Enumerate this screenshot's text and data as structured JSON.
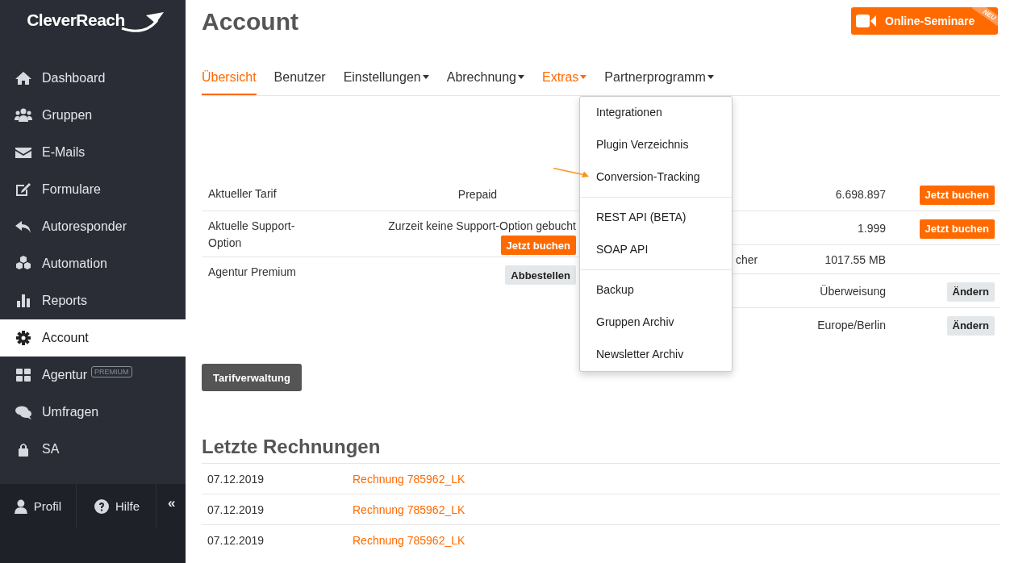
{
  "logo": "CleverReach",
  "sidebar": {
    "items": [
      {
        "label": "Dashboard",
        "selected": false
      },
      {
        "label": "Gruppen",
        "selected": false
      },
      {
        "label": "E-Mails",
        "selected": false
      },
      {
        "label": "Formulare",
        "selected": false
      },
      {
        "label": "Autoresponder",
        "selected": false
      },
      {
        "label": "Automation",
        "selected": false
      },
      {
        "label": "Reports",
        "selected": false
      },
      {
        "label": "Account",
        "selected": true
      },
      {
        "label": "Agentur",
        "selected": false,
        "badge": "PREMIUM"
      },
      {
        "label": "Umfragen",
        "selected": false
      },
      {
        "label": "SA",
        "selected": false
      }
    ],
    "footer": [
      "Profil",
      "Hilfe",
      "«"
    ]
  },
  "page_title": "Account",
  "promo": {
    "label": "Online-Seminare",
    "ribbon": "NEU"
  },
  "tabs": [
    {
      "label": "Übersicht",
      "selected": true,
      "dropdown": false,
      "highlighted": false
    },
    {
      "label": "Benutzer",
      "selected": false,
      "dropdown": false,
      "highlighted": false
    },
    {
      "label": "Einstellungen",
      "selected": false,
      "dropdown": true,
      "highlighted": false
    },
    {
      "label": "Abrechnung",
      "selected": false,
      "dropdown": true,
      "highlighted": false
    },
    {
      "label": "Extras",
      "selected": false,
      "dropdown": true,
      "highlighted": true
    },
    {
      "label": "Partnerprogramm",
      "selected": false,
      "dropdown": true,
      "highlighted": false
    }
  ],
  "extras_menu": [
    [
      "Integrationen",
      "Plugin Verzeichnis",
      "Conversion-Tracking"
    ],
    [
      "REST API (BETA)",
      "SOAP API"
    ],
    [
      "Backup",
      "Gruppen Archiv",
      "Newsletter Archiv"
    ]
  ],
  "left_table": [
    {
      "label": "Aktueller Tarif",
      "value": "Prepaid"
    },
    {
      "label": "Aktuelle Support-Option",
      "value": "Zurzeit keine Support-Option gebucht",
      "button": {
        "label": "Jetzt buchen",
        "kind": "primary"
      }
    },
    {
      "label": "Agentur Premium",
      "button": {
        "label": "Abbestellen",
        "kind": "secondary"
      }
    }
  ],
  "right_table": [
    {
      "value": "6.698.897",
      "button": {
        "label": "Jetzt buchen",
        "kind": "primary"
      }
    },
    {
      "value": "1.999",
      "button": {
        "label": "Jetzt buchen",
        "kind": "primary"
      }
    },
    {
      "label": "cher",
      "value": "1017.55 MB"
    },
    {
      "value": "Überweisung",
      "button": {
        "label": "Ändern",
        "kind": "secondary"
      }
    },
    {
      "value": "Europe/Berlin",
      "button": {
        "label": "Ändern",
        "kind": "secondary"
      }
    }
  ],
  "tarif_button": "Tarifverwaltung",
  "invoices": {
    "title": "Letzte Rechnungen",
    "rows": [
      {
        "date": "07.12.2019",
        "link": "Rechnung 785962_LK"
      },
      {
        "date": "07.12.2019",
        "link": "Rechnung 785962_LK"
      },
      {
        "date": "07.12.2019",
        "link": "Rechnung 785962_LK"
      }
    ]
  }
}
